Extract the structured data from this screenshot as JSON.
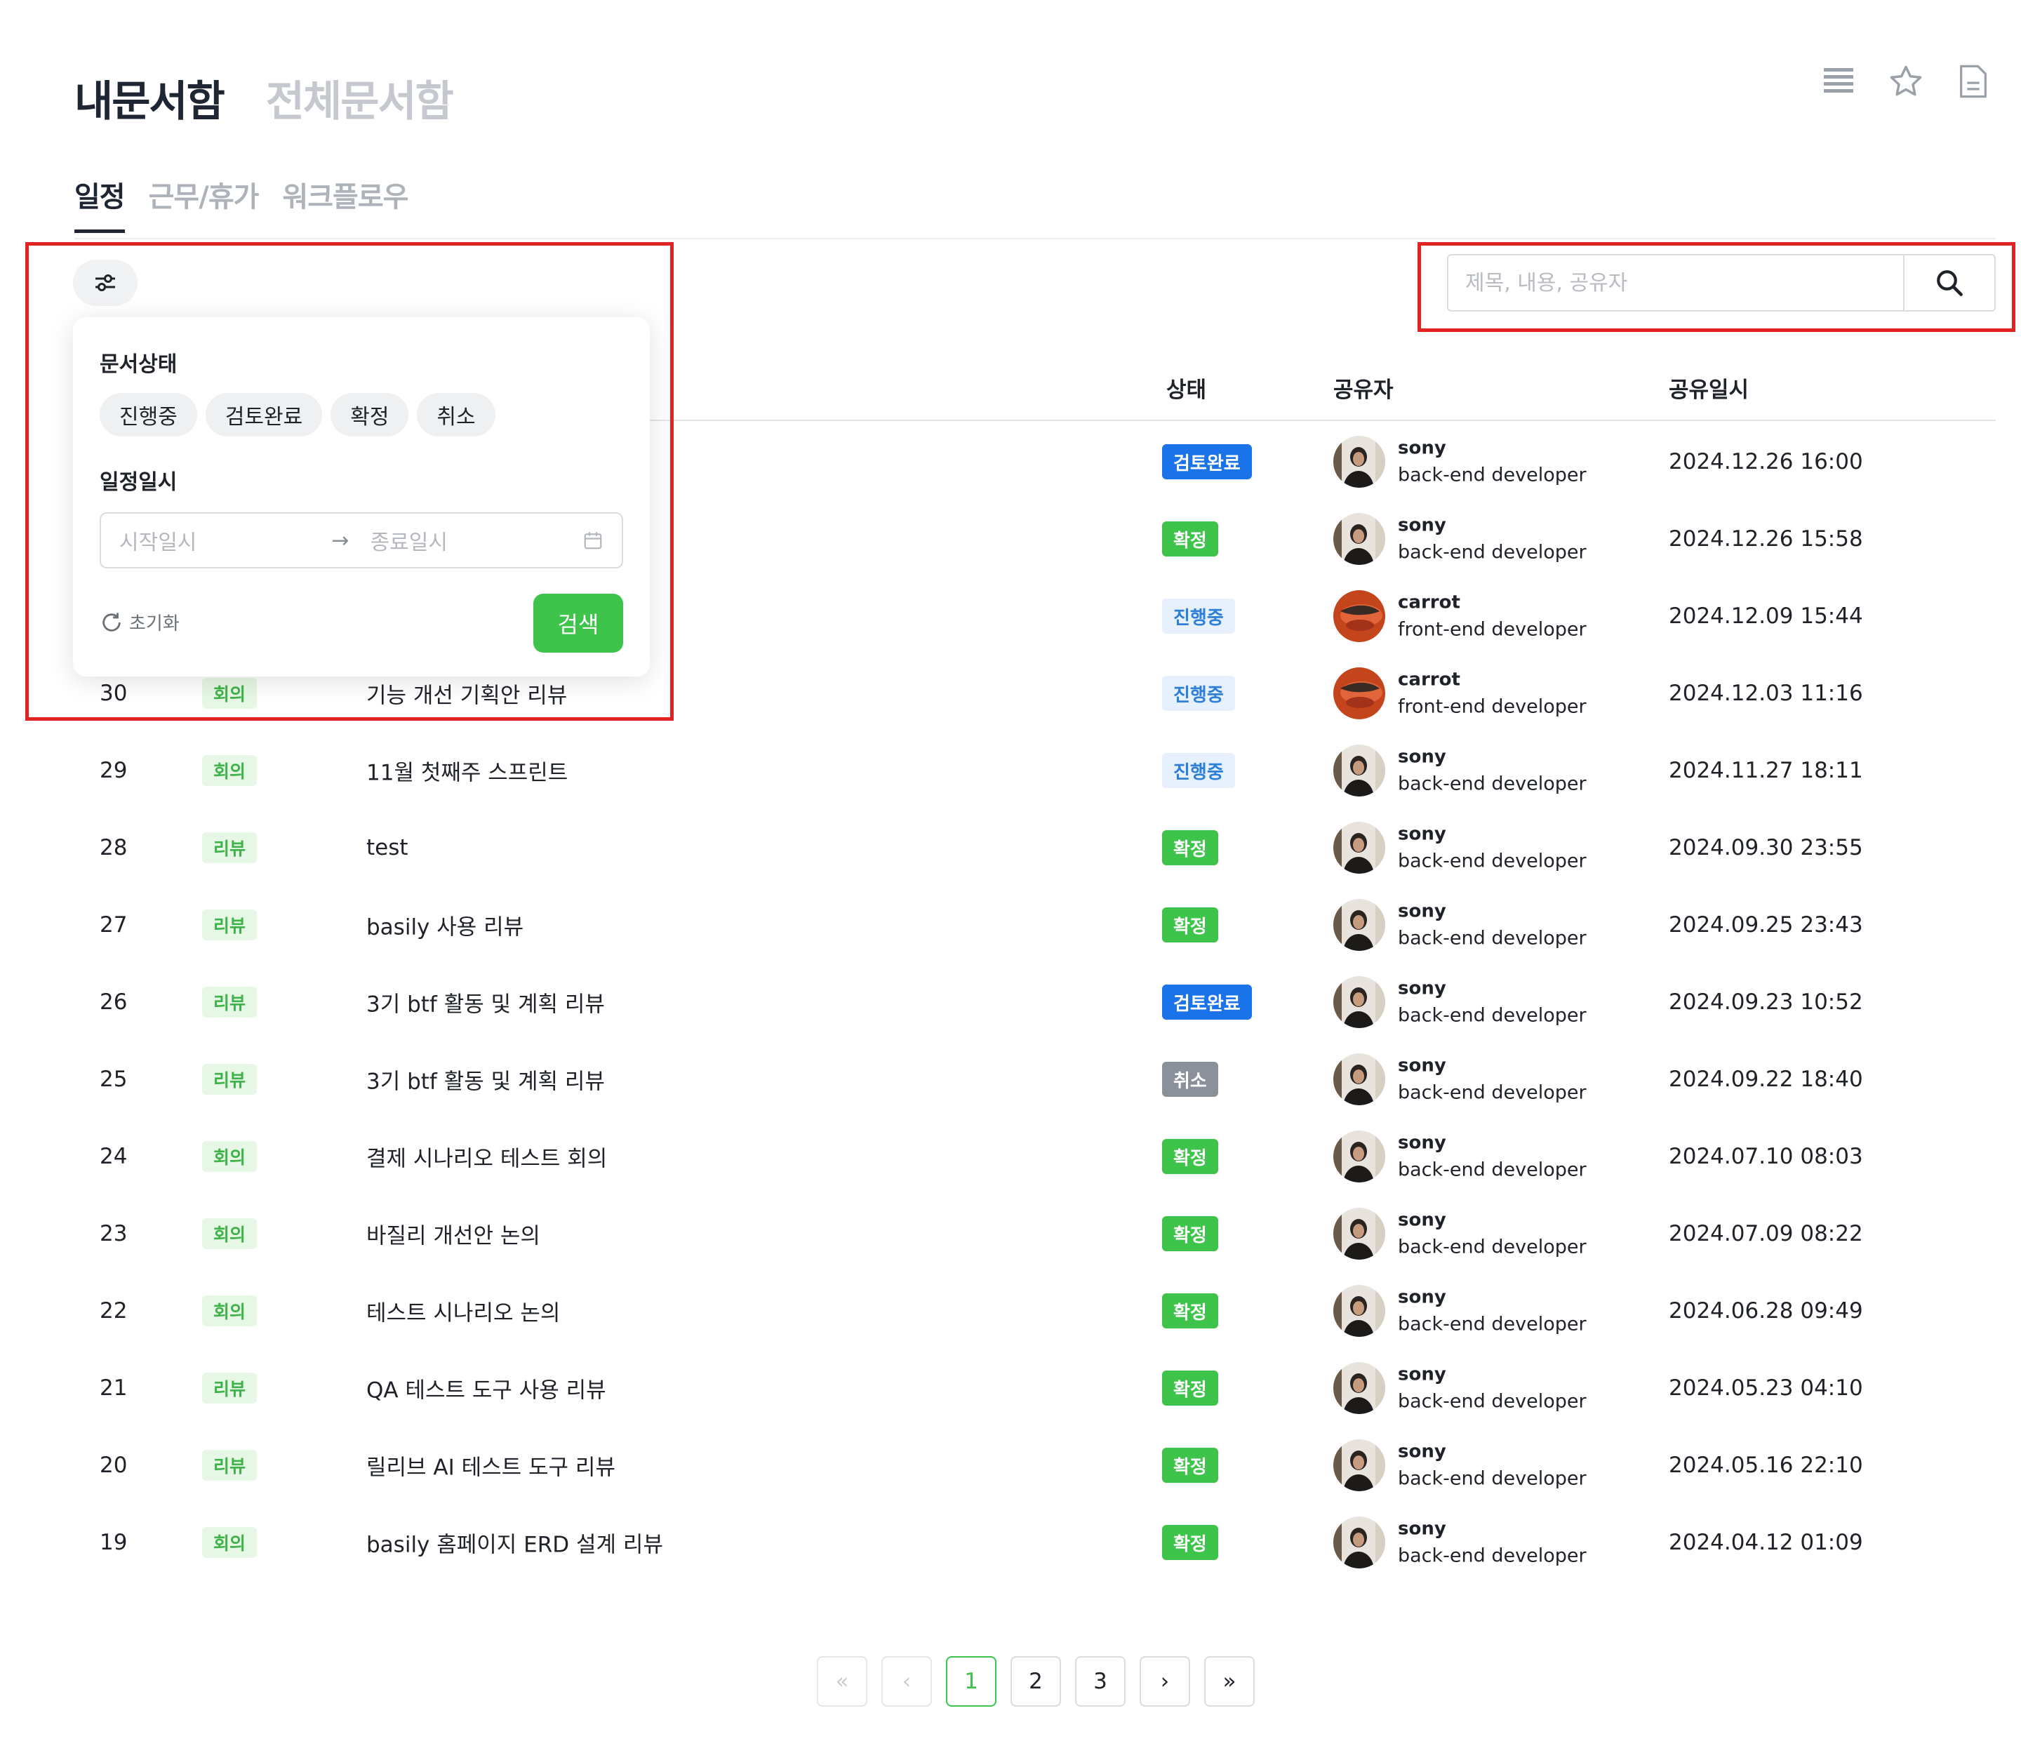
{
  "header": {
    "tabs": [
      {
        "label": "내문서함",
        "active": true
      },
      {
        "label": "전체문서함",
        "active": false
      }
    ]
  },
  "top_icons": [
    "list-icon",
    "star-icon",
    "document-icon"
  ],
  "sub_tabs": [
    {
      "label": "일정",
      "active": true
    },
    {
      "label": "근무/휴가",
      "active": false
    },
    {
      "label": "워크플로우",
      "active": false
    }
  ],
  "filter": {
    "status_label": "문서상태",
    "status_options": [
      "진행중",
      "검토완료",
      "확정",
      "취소"
    ],
    "date_label": "일정일시",
    "start_placeholder": "시작일시",
    "end_placeholder": "종료일시",
    "reset_label": "초기화",
    "search_label": "검색"
  },
  "search": {
    "placeholder": "제목, 내용, 공유자",
    "value": ""
  },
  "table": {
    "headers": {
      "status": "상태",
      "sharer": "공유자",
      "date": "공유일시"
    },
    "rows": [
      {
        "num": "",
        "category": "",
        "title": "",
        "status": "검토완료",
        "status_type": "review",
        "sharer": "sony",
        "role": "back-end developer",
        "date": "2024.12.26 16:00"
      },
      {
        "num": "",
        "category": "",
        "title": "",
        "status": "확정",
        "status_type": "confirm",
        "sharer": "sony",
        "role": "back-end developer",
        "date": "2024.12.26 15:58"
      },
      {
        "num": "",
        "category": "",
        "title": "",
        "status": "진행중",
        "status_type": "progress",
        "sharer": "carrot",
        "role": "front-end developer",
        "date": "2024.12.09 15:44"
      },
      {
        "num": "30",
        "category": "회의",
        "title": "기능 개선 기획안 리뷰",
        "status": "진행중",
        "status_type": "progress",
        "sharer": "carrot",
        "role": "front-end developer",
        "date": "2024.12.03 11:16"
      },
      {
        "num": "29",
        "category": "회의",
        "title": "11월 첫째주 스프린트",
        "status": "진행중",
        "status_type": "progress",
        "sharer": "sony",
        "role": "back-end developer",
        "date": "2024.11.27 18:11"
      },
      {
        "num": "28",
        "category": "리뷰",
        "title": "test",
        "status": "확정",
        "status_type": "confirm",
        "sharer": "sony",
        "role": "back-end developer",
        "date": "2024.09.30 23:55"
      },
      {
        "num": "27",
        "category": "리뷰",
        "title": "basily 사용 리뷰",
        "status": "확정",
        "status_type": "confirm",
        "sharer": "sony",
        "role": "back-end developer",
        "date": "2024.09.25 23:43"
      },
      {
        "num": "26",
        "category": "리뷰",
        "title": "3기 btf 활동 및 계획 리뷰",
        "status": "검토완료",
        "status_type": "review",
        "sharer": "sony",
        "role": "back-end developer",
        "date": "2024.09.23 10:52"
      },
      {
        "num": "25",
        "category": "리뷰",
        "title": "3기 btf 활동 및 계획 리뷰",
        "status": "취소",
        "status_type": "cancel",
        "sharer": "sony",
        "role": "back-end developer",
        "date": "2024.09.22 18:40"
      },
      {
        "num": "24",
        "category": "회의",
        "title": "결제 시나리오 테스트 회의",
        "status": "확정",
        "status_type": "confirm",
        "sharer": "sony",
        "role": "back-end developer",
        "date": "2024.07.10 08:03"
      },
      {
        "num": "23",
        "category": "회의",
        "title": "바질리 개선안 논의",
        "status": "확정",
        "status_type": "confirm",
        "sharer": "sony",
        "role": "back-end developer",
        "date": "2024.07.09 08:22"
      },
      {
        "num": "22",
        "category": "회의",
        "title": "테스트 시나리오 논의",
        "status": "확정",
        "status_type": "confirm",
        "sharer": "sony",
        "role": "back-end developer",
        "date": "2024.06.28 09:49"
      },
      {
        "num": "21",
        "category": "리뷰",
        "title": "QA 테스트 도구 사용 리뷰",
        "status": "확정",
        "status_type": "confirm",
        "sharer": "sony",
        "role": "back-end developer",
        "date": "2024.05.23 04:10"
      },
      {
        "num": "20",
        "category": "리뷰",
        "title": "릴리브 AI 테스트 도구 리뷰",
        "status": "확정",
        "status_type": "confirm",
        "sharer": "sony",
        "role": "back-end developer",
        "date": "2024.05.16 22:10"
      },
      {
        "num": "19",
        "category": "회의",
        "title": "basily 홈페이지 ERD 설계 리뷰",
        "status": "확정",
        "status_type": "confirm",
        "sharer": "sony",
        "role": "back-end developer",
        "date": "2024.04.12 01:09"
      }
    ]
  },
  "pagination": {
    "first": "«",
    "prev": "‹",
    "pages": [
      "1",
      "2",
      "3"
    ],
    "current": "1",
    "next": "›",
    "last": "»"
  },
  "colors": {
    "accent_green": "#3fc44b",
    "review_blue": "#1a73e8",
    "progress_bg": "#e6f1fd",
    "cancel_gray": "#8a919a",
    "highlight_red": "#e02424"
  }
}
